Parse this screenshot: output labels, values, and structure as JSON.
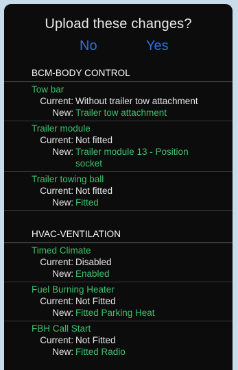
{
  "dialog": {
    "title": "Upload these changes?",
    "no_label": "No",
    "yes_label": "Yes"
  },
  "sections": [
    {
      "header": "BCM-BODY CONTROL",
      "items": [
        {
          "name": "Tow bar",
          "current_label": "Current:",
          "current": "Without trailer tow attachment",
          "new_label": "New:",
          "new": "Trailer tow attachment"
        },
        {
          "name": "Trailer module",
          "current_label": "Current:",
          "current": "Not fitted",
          "new_label": "New:",
          "new": "Trailer module  13  -  Position socket"
        },
        {
          "name": "Trailer towing ball",
          "current_label": "Current:",
          "current": "Not fitted",
          "new_label": "New:",
          "new": "Fitted"
        }
      ]
    },
    {
      "header": "HVAC-VENTILATION",
      "items": [
        {
          "name": "Timed Climate",
          "current_label": "Current:",
          "current": "Disabled",
          "new_label": "New:",
          "new": "Enabled"
        },
        {
          "name": "Fuel Burning Heater",
          "current_label": "Current:",
          "current": "Not Fitted",
          "new_label": "New:",
          "new": "Fitted Parking Heat"
        },
        {
          "name": "FBH Call Start",
          "current_label": "Current:",
          "current": "Not Fitted",
          "new_label": "New:",
          "new": "Fitted Radio"
        }
      ]
    }
  ]
}
